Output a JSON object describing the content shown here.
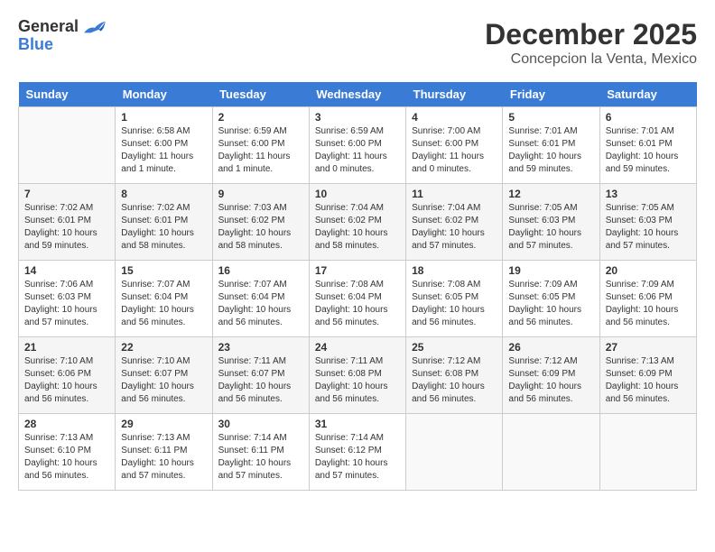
{
  "header": {
    "logo_general": "General",
    "logo_blue": "Blue",
    "month": "December 2025",
    "location": "Concepcion la Venta, Mexico"
  },
  "days_of_week": [
    "Sunday",
    "Monday",
    "Tuesday",
    "Wednesday",
    "Thursday",
    "Friday",
    "Saturday"
  ],
  "weeks": [
    [
      {
        "day": "",
        "info": ""
      },
      {
        "day": "1",
        "info": "Sunrise: 6:58 AM\nSunset: 6:00 PM\nDaylight: 11 hours\nand 1 minute."
      },
      {
        "day": "2",
        "info": "Sunrise: 6:59 AM\nSunset: 6:00 PM\nDaylight: 11 hours\nand 1 minute."
      },
      {
        "day": "3",
        "info": "Sunrise: 6:59 AM\nSunset: 6:00 PM\nDaylight: 11 hours\nand 0 minutes."
      },
      {
        "day": "4",
        "info": "Sunrise: 7:00 AM\nSunset: 6:00 PM\nDaylight: 11 hours\nand 0 minutes."
      },
      {
        "day": "5",
        "info": "Sunrise: 7:01 AM\nSunset: 6:01 PM\nDaylight: 10 hours\nand 59 minutes."
      },
      {
        "day": "6",
        "info": "Sunrise: 7:01 AM\nSunset: 6:01 PM\nDaylight: 10 hours\nand 59 minutes."
      }
    ],
    [
      {
        "day": "7",
        "info": "Sunrise: 7:02 AM\nSunset: 6:01 PM\nDaylight: 10 hours\nand 59 minutes."
      },
      {
        "day": "8",
        "info": "Sunrise: 7:02 AM\nSunset: 6:01 PM\nDaylight: 10 hours\nand 58 minutes."
      },
      {
        "day": "9",
        "info": "Sunrise: 7:03 AM\nSunset: 6:02 PM\nDaylight: 10 hours\nand 58 minutes."
      },
      {
        "day": "10",
        "info": "Sunrise: 7:04 AM\nSunset: 6:02 PM\nDaylight: 10 hours\nand 58 minutes."
      },
      {
        "day": "11",
        "info": "Sunrise: 7:04 AM\nSunset: 6:02 PM\nDaylight: 10 hours\nand 57 minutes."
      },
      {
        "day": "12",
        "info": "Sunrise: 7:05 AM\nSunset: 6:03 PM\nDaylight: 10 hours\nand 57 minutes."
      },
      {
        "day": "13",
        "info": "Sunrise: 7:05 AM\nSunset: 6:03 PM\nDaylight: 10 hours\nand 57 minutes."
      }
    ],
    [
      {
        "day": "14",
        "info": "Sunrise: 7:06 AM\nSunset: 6:03 PM\nDaylight: 10 hours\nand 57 minutes."
      },
      {
        "day": "15",
        "info": "Sunrise: 7:07 AM\nSunset: 6:04 PM\nDaylight: 10 hours\nand 56 minutes."
      },
      {
        "day": "16",
        "info": "Sunrise: 7:07 AM\nSunset: 6:04 PM\nDaylight: 10 hours\nand 56 minutes."
      },
      {
        "day": "17",
        "info": "Sunrise: 7:08 AM\nSunset: 6:04 PM\nDaylight: 10 hours\nand 56 minutes."
      },
      {
        "day": "18",
        "info": "Sunrise: 7:08 AM\nSunset: 6:05 PM\nDaylight: 10 hours\nand 56 minutes."
      },
      {
        "day": "19",
        "info": "Sunrise: 7:09 AM\nSunset: 6:05 PM\nDaylight: 10 hours\nand 56 minutes."
      },
      {
        "day": "20",
        "info": "Sunrise: 7:09 AM\nSunset: 6:06 PM\nDaylight: 10 hours\nand 56 minutes."
      }
    ],
    [
      {
        "day": "21",
        "info": "Sunrise: 7:10 AM\nSunset: 6:06 PM\nDaylight: 10 hours\nand 56 minutes."
      },
      {
        "day": "22",
        "info": "Sunrise: 7:10 AM\nSunset: 6:07 PM\nDaylight: 10 hours\nand 56 minutes."
      },
      {
        "day": "23",
        "info": "Sunrise: 7:11 AM\nSunset: 6:07 PM\nDaylight: 10 hours\nand 56 minutes."
      },
      {
        "day": "24",
        "info": "Sunrise: 7:11 AM\nSunset: 6:08 PM\nDaylight: 10 hours\nand 56 minutes."
      },
      {
        "day": "25",
        "info": "Sunrise: 7:12 AM\nSunset: 6:08 PM\nDaylight: 10 hours\nand 56 minutes."
      },
      {
        "day": "26",
        "info": "Sunrise: 7:12 AM\nSunset: 6:09 PM\nDaylight: 10 hours\nand 56 minutes."
      },
      {
        "day": "27",
        "info": "Sunrise: 7:13 AM\nSunset: 6:09 PM\nDaylight: 10 hours\nand 56 minutes."
      }
    ],
    [
      {
        "day": "28",
        "info": "Sunrise: 7:13 AM\nSunset: 6:10 PM\nDaylight: 10 hours\nand 56 minutes."
      },
      {
        "day": "29",
        "info": "Sunrise: 7:13 AM\nSunset: 6:11 PM\nDaylight: 10 hours\nand 57 minutes."
      },
      {
        "day": "30",
        "info": "Sunrise: 7:14 AM\nSunset: 6:11 PM\nDaylight: 10 hours\nand 57 minutes."
      },
      {
        "day": "31",
        "info": "Sunrise: 7:14 AM\nSunset: 6:12 PM\nDaylight: 10 hours\nand 57 minutes."
      },
      {
        "day": "",
        "info": ""
      },
      {
        "day": "",
        "info": ""
      },
      {
        "day": "",
        "info": ""
      }
    ]
  ]
}
